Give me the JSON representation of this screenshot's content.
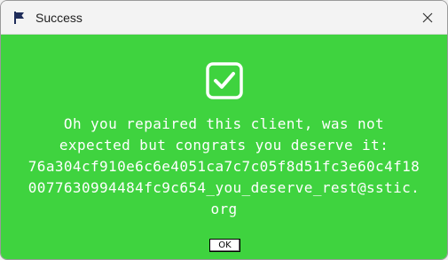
{
  "window": {
    "title": "Success",
    "title_icon": "flag-icon",
    "close_icon": "close-icon"
  },
  "content": {
    "background_color": "#3fd33f",
    "status_icon": "check-icon",
    "message_lines": [
      "Oh you repaired this client, was not",
      "expected but congrats you deserve it:",
      "76a304cf910e6c6e4051ca7c7c05f8d51fc3e60c4f18",
      "0077630994484fc9c654_you_deserve_rest@sstic.",
      "org"
    ]
  },
  "buttons": {
    "ok_label": "OK"
  }
}
